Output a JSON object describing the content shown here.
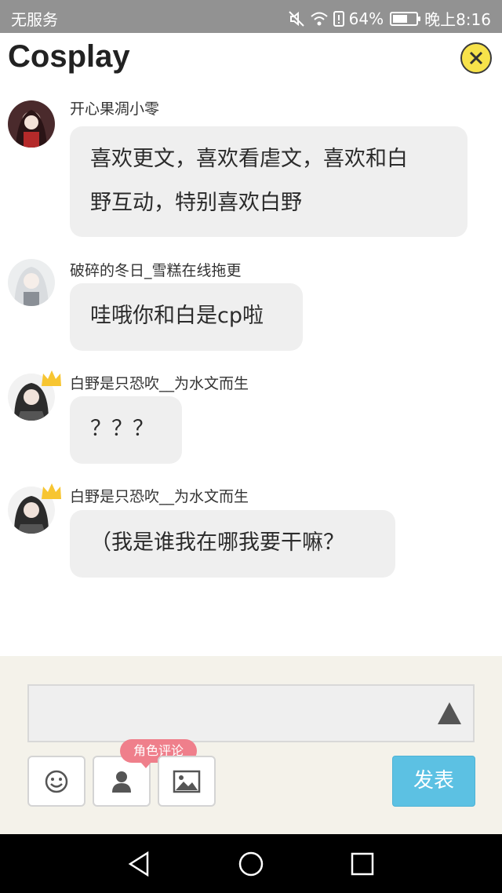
{
  "status_bar": {
    "carrier": "无服务",
    "battery": "64%",
    "battery_level": 0.64,
    "time": "晚上8:16"
  },
  "header": {
    "title": "Cosplay"
  },
  "messages": [
    {
      "username": "开心果凋小零",
      "lines": [
        "喜欢更文，喜欢看虐文，喜欢和白",
        "野互动，特别喜欢白野"
      ]
    },
    {
      "username": "破碎的冬日_雪糕在线拖更",
      "lines": [
        "哇哦你和白是cp啦"
      ]
    },
    {
      "username": "白野是只恐吹__为水文而生",
      "lines": [
        "？？？"
      ]
    },
    {
      "username": "白野是只恐吹__为水文而生",
      "lines": [
        "（我是谁我在哪我要干嘛？"
      ]
    }
  ],
  "composer": {
    "input_value": "",
    "role_tag": "角色评论",
    "send_label": "发表"
  },
  "icons": {
    "close": "close-icon",
    "expand": "expand-up-icon",
    "emoji": "emoji-icon",
    "role": "person-icon",
    "image": "image-icon",
    "back": "back-icon",
    "home": "home-icon",
    "recents": "recents-icon"
  },
  "colors": {
    "status_bar": "#929292",
    "close_button": "#f7e24a",
    "bubble": "#efefef",
    "composer_bg": "#f4f2ea",
    "role_tag": "#ef7f8b",
    "send_button": "#5cc1e3"
  }
}
